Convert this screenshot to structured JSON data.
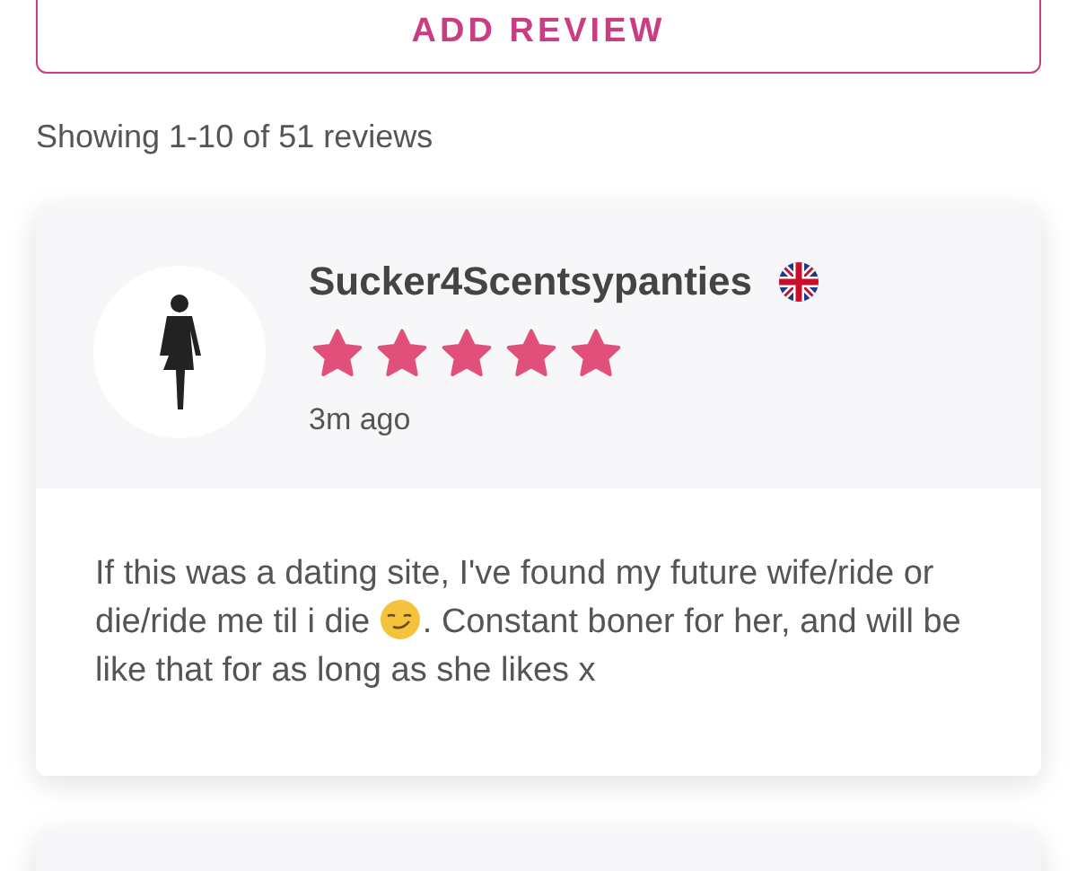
{
  "add_review_button": {
    "label": "ADD REVIEW"
  },
  "summary": "Showing 1-10 of 51 reviews",
  "reviews": [
    {
      "username": "Sucker4Scentsypanties",
      "stars": 5,
      "time": "3m ago",
      "body": [
        {
          "kind": "text",
          "text": "If this was a dating site, I've found my future wife/ride or die/ride me til i die "
        },
        {
          "kind": "emoji"
        },
        {
          "kind": "text",
          "text": ". Constant boner for her, and will be like that for as long as she likes x"
        }
      ]
    }
  ]
}
